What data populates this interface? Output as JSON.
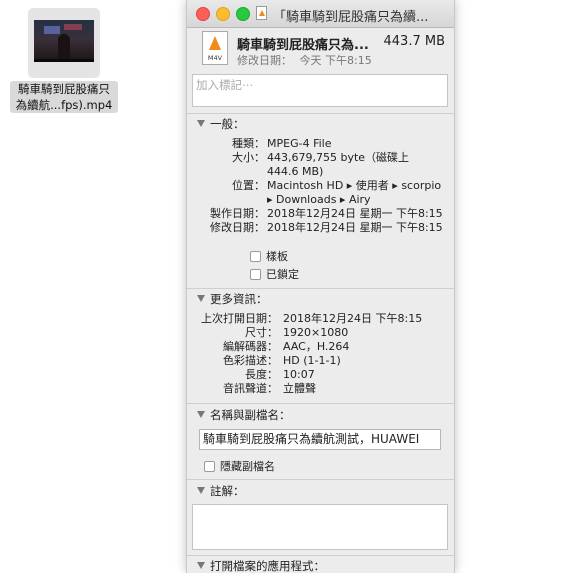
{
  "desktop": {
    "file_label_line1": "騎車騎到屁股痛只",
    "file_label_line2": "為續航...fps).mp4"
  },
  "window": {
    "title": "「騎車騎到屁股痛只為續...",
    "file_name": "騎車騎到屁股痛只為...",
    "file_size": "443.7 MB",
    "modified_label": "修改日期：",
    "modified_value": "今天 下午8:15",
    "doc_icon_tag": "M4V",
    "tags_placeholder": "加入標記⋯"
  },
  "general": {
    "title": "一般：",
    "rows": [
      {
        "k": "種類：",
        "v": "MPEG-4 File"
      },
      {
        "k": "大小：",
        "v": "443,679,755 byte（磁碟上"
      },
      {
        "k": "",
        "v": "444.6 MB)"
      },
      {
        "k": "位置：",
        "v": "Macintosh HD ▸ 使用者 ▸ scorpio"
      },
      {
        "k": "",
        "v": "▸ Downloads ▸ Airy"
      },
      {
        "k": "製作日期：",
        "v": "2018年12月24日 星期一 下午8:15"
      },
      {
        "k": "修改日期：",
        "v": "2018年12月24日 星期一 下午8:15"
      }
    ],
    "stationery_label": "樣板",
    "locked_label": "已鎖定"
  },
  "more_info": {
    "title": "更多資訊：",
    "rows": [
      {
        "k": "上次打開日期：",
        "v": "2018年12月24日 下午8:15"
      },
      {
        "k": "尺寸：",
        "v": "1920×1080"
      },
      {
        "k": "編解碼器：",
        "v": "AAC，H.264"
      },
      {
        "k": "色彩描述：",
        "v": "HD (1-1-1)"
      },
      {
        "k": "長度：",
        "v": "10:07"
      },
      {
        "k": "音訊聲道：",
        "v": "立體聲"
      }
    ]
  },
  "name_ext": {
    "title": "名稱與副檔名：",
    "name_value": "騎車騎到屁股痛只為續航測試，HUAWEI",
    "hide_ext_label": "隱藏副檔名"
  },
  "comments": {
    "title": "註解："
  },
  "open_with": {
    "title": "打開檔案的應用程式："
  }
}
